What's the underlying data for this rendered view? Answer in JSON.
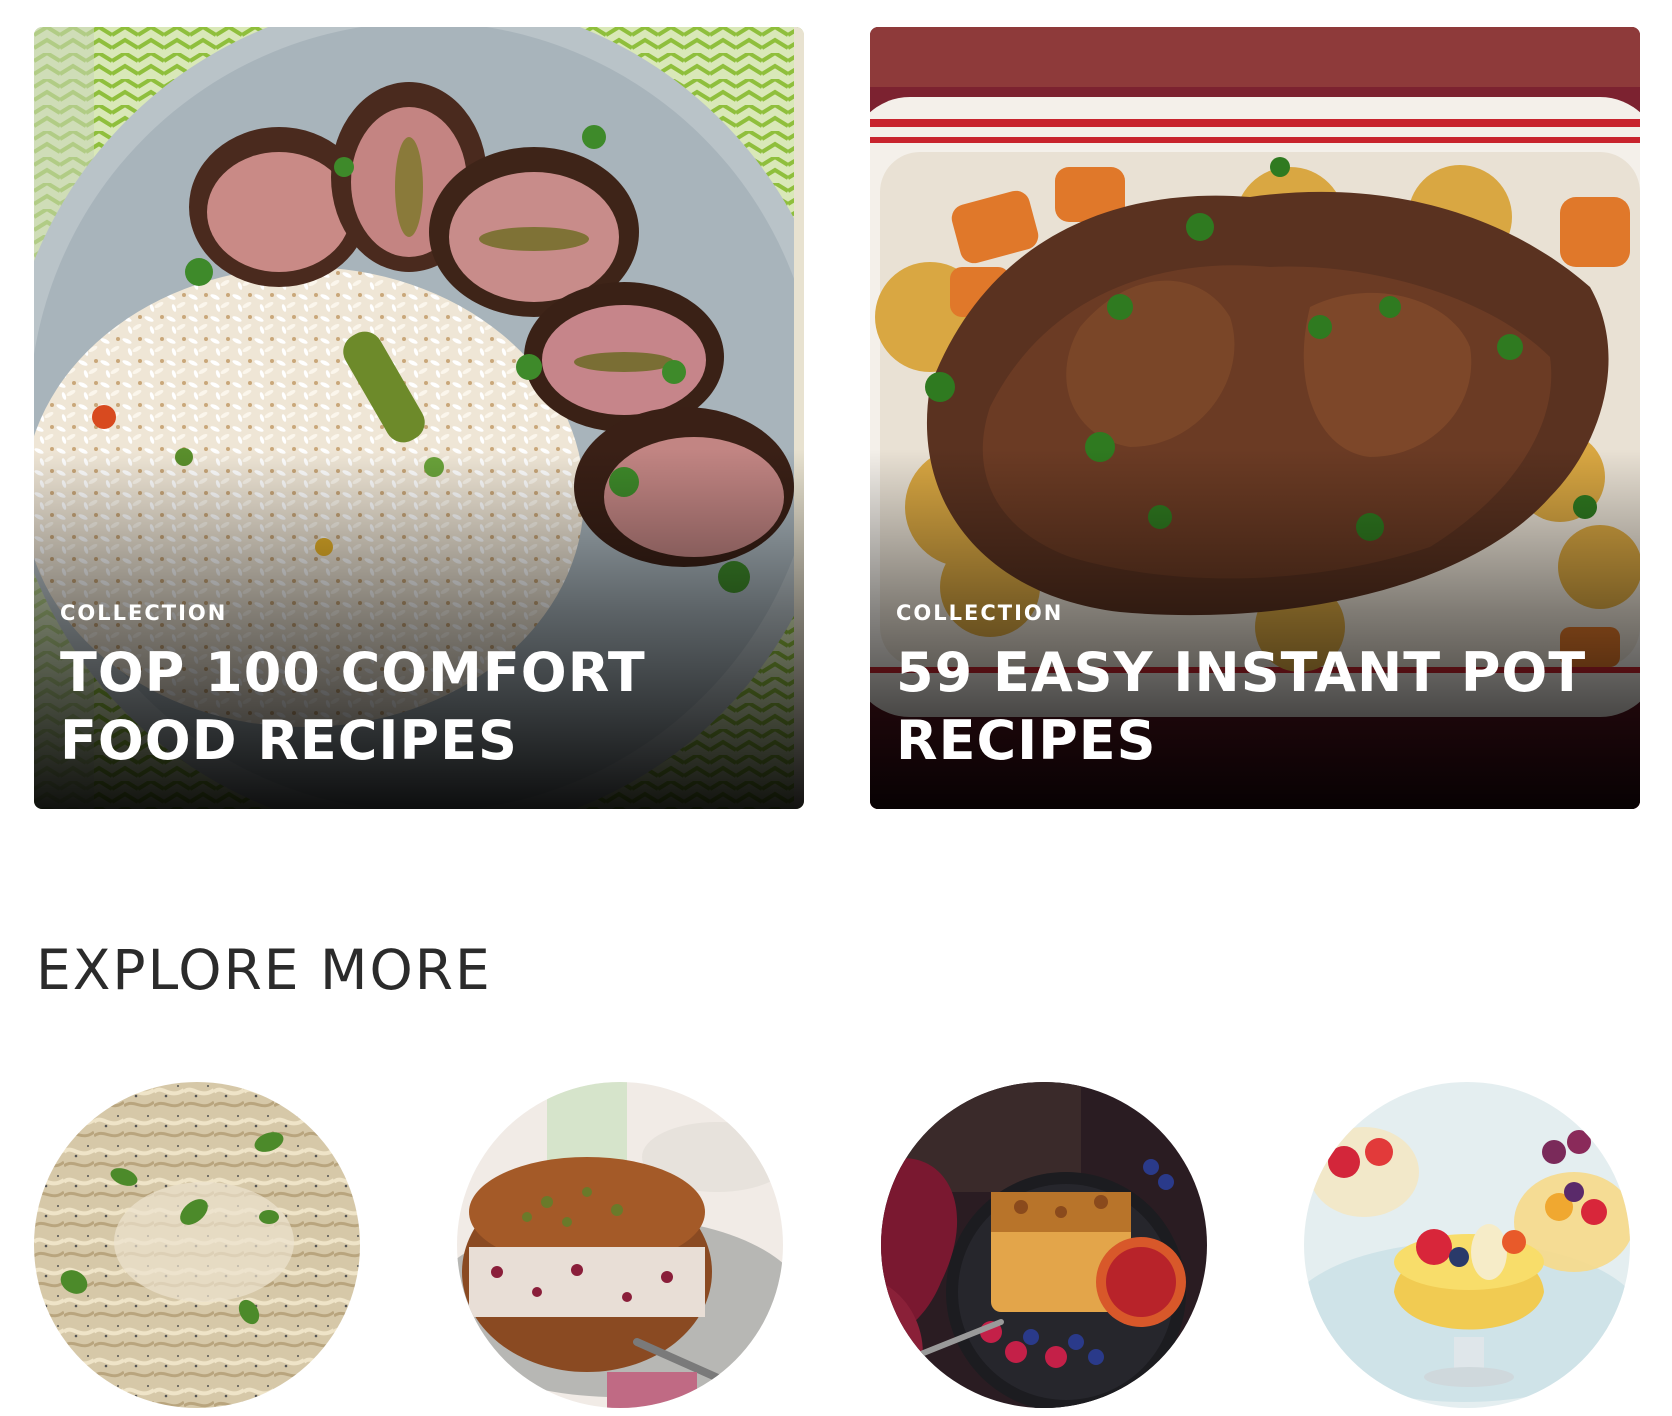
{
  "collections": [
    {
      "kicker": "COLLECTION",
      "title": "TOP 100 COMFORT FOOD RECIPES",
      "image_subject": "stuffed-pork-tenderloin-with-rice"
    },
    {
      "kicker": "COLLECTION",
      "title": "59 EASY INSTANT POT RECIPES",
      "image_subject": "pot-roast-with-potatoes-and-carrots"
    }
  ],
  "explore": {
    "title": "EXPLORE MORE",
    "items": [
      {
        "image_subject": "cacio-e-pepe-pasta"
      },
      {
        "image_subject": "persian-rice-cake-with-pistachios"
      },
      {
        "image_subject": "breakfast-casserole-with-berries"
      },
      {
        "image_subject": "fruit-salad-cups"
      }
    ]
  }
}
